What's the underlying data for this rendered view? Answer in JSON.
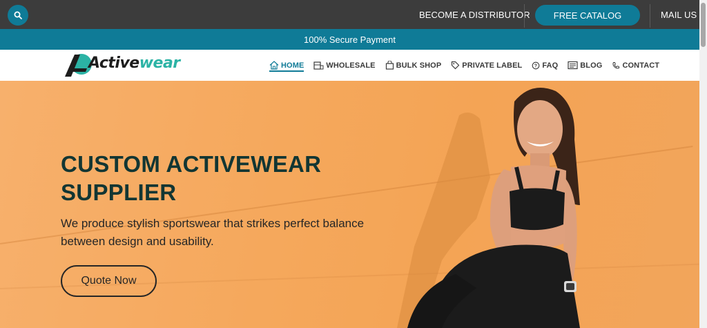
{
  "topbar": {
    "distributor_label": "BECOME A DISTRIBUTOR",
    "catalog_label": "FREE CATALOG",
    "mail_label": "MAIL US"
  },
  "secure_bar": {
    "text": "100% Secure Payment"
  },
  "logo": {
    "text_main": "Active",
    "text_accent": "wear"
  },
  "nav": {
    "items": [
      {
        "label": "HOME",
        "icon": "home-icon"
      },
      {
        "label": "WHOLESALE",
        "icon": "warehouse-icon"
      },
      {
        "label": "BULK SHOP",
        "icon": "bag-icon"
      },
      {
        "label": "PRIVATE LABEL",
        "icon": "tag-icon"
      },
      {
        "label": "FAQ",
        "icon": "question-icon"
      },
      {
        "label": "BLOG",
        "icon": "blog-icon"
      },
      {
        "label": "CONTACT",
        "icon": "phone-icon"
      }
    ]
  },
  "hero": {
    "title": "CUSTOM ACTIVEWEAR SUPPLIER",
    "subtitle": "We produce stylish sportswear that strikes perfect balance between design and usability.",
    "cta_label": "Quote Now"
  },
  "colors": {
    "accent": "#0f7b97",
    "topbar_bg": "#3c3c3c",
    "hero_bg": "#f5a85c",
    "hero_title": "#123633",
    "logo_accent": "#2bb3a5"
  }
}
